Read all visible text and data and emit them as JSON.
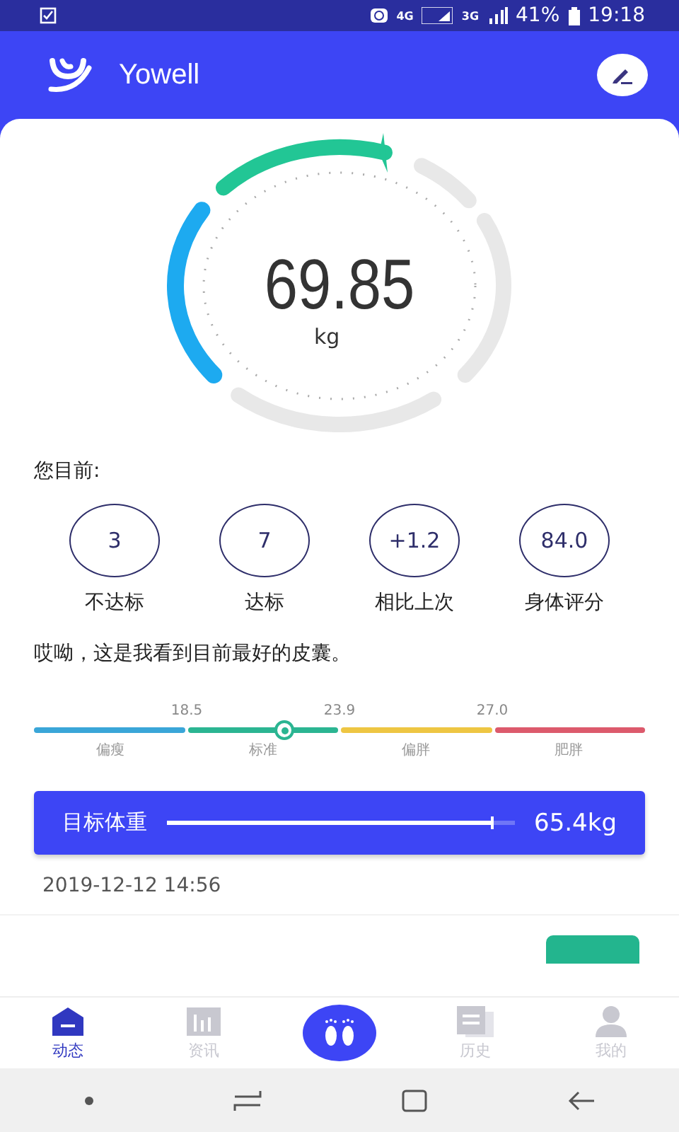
{
  "status_bar": {
    "network_labels": [
      "4G",
      "3G"
    ],
    "battery": "41%",
    "time": "19:18"
  },
  "header": {
    "title": "Yowell"
  },
  "weight": {
    "value": "69.85",
    "unit": "kg"
  },
  "summary": {
    "title": "您目前:",
    "stats": [
      {
        "value": "3",
        "label": "不达标"
      },
      {
        "value": "7",
        "label": "达标"
      },
      {
        "value": "+1.2",
        "label": "相比上次"
      },
      {
        "value": "84.0",
        "label": "身体评分"
      }
    ]
  },
  "comment": "哎呦，这是我看到目前最好的皮囊。",
  "bmi_scale": {
    "thresholds": [
      "18.5",
      "23.9",
      "27.0"
    ],
    "segments": [
      {
        "label": "偏瘦",
        "color": "#3aa6d8"
      },
      {
        "label": "标准",
        "color": "#2bb592"
      },
      {
        "label": "偏胖",
        "color": "#eec643"
      },
      {
        "label": "肥胖",
        "color": "#dc5a6c"
      }
    ]
  },
  "target": {
    "label": "目标体重",
    "value": "65.4kg"
  },
  "record": {
    "time": "2019-12-12 14:56"
  },
  "tabs": [
    {
      "label": "动态",
      "selected": true,
      "kind": "home"
    },
    {
      "label": "资讯",
      "selected": false,
      "kind": "news"
    },
    {
      "kind": "measure",
      "selected": false
    },
    {
      "label": "历史",
      "selected": false,
      "kind": "history"
    },
    {
      "label": "我的",
      "selected": false,
      "kind": "profile"
    }
  ]
}
